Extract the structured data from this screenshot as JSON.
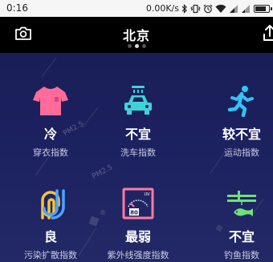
{
  "status_bar": {
    "time": "0:16",
    "network_speed": "0.00K/s",
    "battery_level": 0.85
  },
  "header": {
    "city": "北京",
    "page_count": 3,
    "active_page": 1
  },
  "indices": [
    {
      "icon": "tshirt-icon",
      "value": "冷",
      "label": "穿衣指数"
    },
    {
      "icon": "car-wash-icon",
      "value": "不宜",
      "label": "洗车指数"
    },
    {
      "icon": "running-person-icon",
      "value": "较不宜",
      "label": "运动指数"
    },
    {
      "icon": "pollution-wind-icon",
      "value": "良",
      "label": "污染扩散指数"
    },
    {
      "icon": "uv-meter-icon",
      "value": "最弱",
      "label": "紫外线强度指数"
    },
    {
      "icon": "fishing-icon",
      "value": "不宜",
      "label": "钓鱼指数"
    }
  ],
  "decorations": {
    "pm_label": "PM2.5"
  },
  "colors": {
    "panel_background": "#1c2160",
    "tshirt": "#ff6b9b",
    "car_wash": "#3fd3d8",
    "running": "#33c3f5",
    "pollution_yellow": "#f2c53d",
    "pollution_blue": "#4da3ff",
    "uv": "#ff7aa2",
    "fishing": "#6fe07a"
  }
}
